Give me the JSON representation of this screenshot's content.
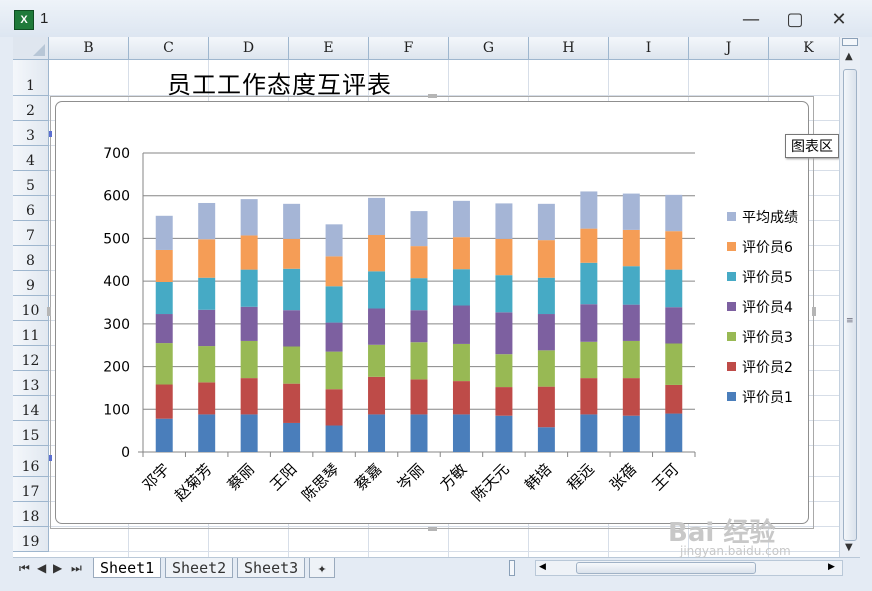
{
  "window": {
    "title": "1",
    "app_icon": "excel-icon",
    "controls": {
      "minimize_icon": "minimize-icon",
      "maximize_icon": "maximize-icon",
      "close_icon": "close-icon"
    }
  },
  "grid": {
    "columns": [
      "B",
      "C",
      "D",
      "E",
      "F",
      "G",
      "H",
      "I",
      "J",
      "K"
    ],
    "rows": [
      "1",
      "2",
      "3",
      "4",
      "5",
      "6",
      "7",
      "8",
      "9",
      "10",
      "11",
      "12",
      "13",
      "14",
      "15",
      "16",
      "17",
      "18",
      "19"
    ]
  },
  "sheet": {
    "title_cell": "员工工作态度互评表"
  },
  "tooltip": "图表区",
  "tabs": [
    "Sheet1",
    "Sheet2",
    "Sheet3"
  ],
  "active_tab": 0,
  "watermark": {
    "text": "Bai 经验",
    "sub": "jingyan.baidu.com"
  },
  "colors": {
    "评价员1": "#4a7ebb",
    "评价员2": "#be4b48",
    "评价员3": "#98b954",
    "评价员4": "#7d60a0",
    "评价员5": "#46aac5",
    "评价员6": "#f59d56",
    "平均成绩": "#a5b5d6"
  },
  "chart_data": {
    "type": "bar",
    "stacked": true,
    "categories": [
      "邓宇",
      "赵菊芳",
      "蔡丽",
      "王阳",
      "陈思琴",
      "蔡嘉",
      "岑丽",
      "方敏",
      "陈天元",
      "韩培",
      "程远",
      "张蓓",
      "王可"
    ],
    "ylim": [
      0,
      700
    ],
    "yticks": [
      0,
      100,
      200,
      300,
      400,
      500,
      600,
      700
    ],
    "grid": true,
    "legend_position": "right",
    "series": [
      {
        "name": "评价员1",
        "values": [
          78,
          88,
          88,
          68,
          62,
          88,
          88,
          88,
          85,
          58,
          88,
          85,
          90
        ]
      },
      {
        "name": "评价员2",
        "values": [
          80,
          75,
          85,
          92,
          85,
          88,
          82,
          78,
          67,
          95,
          85,
          88,
          67
        ]
      },
      {
        "name": "评价员3",
        "values": [
          97,
          85,
          87,
          87,
          88,
          75,
          87,
          87,
          77,
          85,
          85,
          87,
          97
        ]
      },
      {
        "name": "评价员4",
        "values": [
          68,
          85,
          80,
          85,
          68,
          85,
          75,
          90,
          98,
          85,
          88,
          85,
          85
        ]
      },
      {
        "name": "评价员5",
        "values": [
          75,
          75,
          87,
          97,
          85,
          87,
          75,
          85,
          87,
          85,
          97,
          90,
          88
        ]
      },
      {
        "name": "评价员6",
        "values": [
          75,
          90,
          80,
          70,
          70,
          85,
          75,
          75,
          85,
          88,
          80,
          85,
          90
        ]
      },
      {
        "name": "平均成绩",
        "values": [
          80,
          85,
          85,
          82,
          75,
          87,
          82,
          85,
          83,
          85,
          87,
          85,
          85
        ]
      }
    ]
  }
}
